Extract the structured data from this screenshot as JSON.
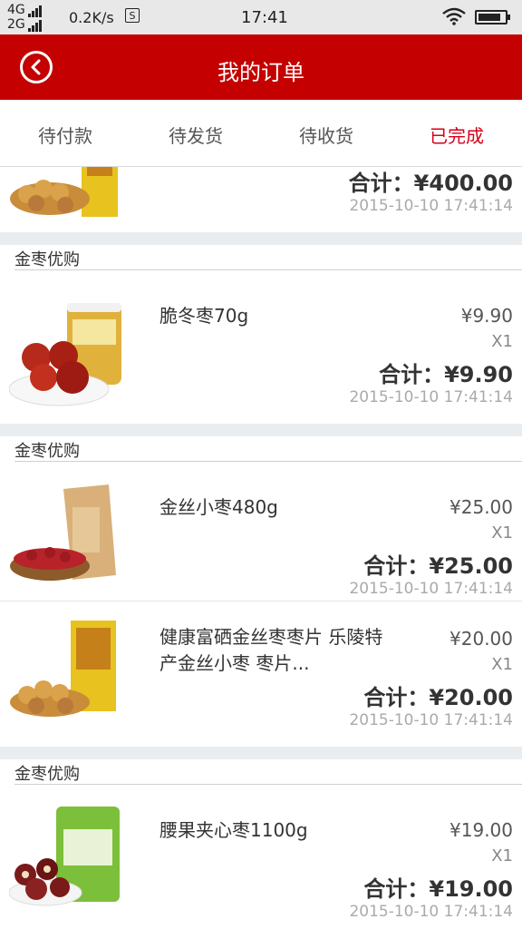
{
  "status_bar": {
    "network_4g": "4G",
    "network_2g": "2G",
    "speed": "0.2K/s",
    "sim_label": "S",
    "time": "17:41"
  },
  "header": {
    "title": "我的订单"
  },
  "tabs": [
    {
      "label": "待付款",
      "active": false
    },
    {
      "label": "待发货",
      "active": false
    },
    {
      "label": "待收货",
      "active": false
    },
    {
      "label": "已完成",
      "active": true
    }
  ],
  "orders": [
    {
      "items": [
        {
          "total": "合计：¥400.00",
          "time": "2015-10-10 17:41:14"
        }
      ]
    },
    {
      "shop": "金枣优购",
      "items": [
        {
          "name": "脆冬枣70g",
          "price": "¥9.90",
          "qty": "X1",
          "total": "合计：¥9.90",
          "time": "2015-10-10 17:41:14"
        }
      ]
    },
    {
      "shop": "金枣优购",
      "items": [
        {
          "name": "金丝小枣480g",
          "price": "¥25.00",
          "qty": "X1",
          "total": "合计：¥25.00",
          "time": "2015-10-10 17:41:14"
        },
        {
          "name": "健康富硒金丝枣枣片 乐陵特产金丝小枣 枣片...",
          "price": "¥20.00",
          "qty": "X1",
          "total": "合计：¥20.00",
          "time": "2015-10-10 17:41:14"
        }
      ]
    },
    {
      "shop": "金枣优购",
      "items": [
        {
          "name": "腰果夹心枣1100g",
          "price": "¥19.00",
          "qty": "X1",
          "total": "合计：¥19.00",
          "time": "2015-10-10 17:41:14"
        }
      ]
    }
  ],
  "colors": {
    "brand_red": "#c40000",
    "active_tab": "#d4001a",
    "separator": "#e9edf0"
  },
  "icons": [
    "back-icon",
    "wifi-icon",
    "battery-icon",
    "signal-icon",
    "sim-icon"
  ]
}
